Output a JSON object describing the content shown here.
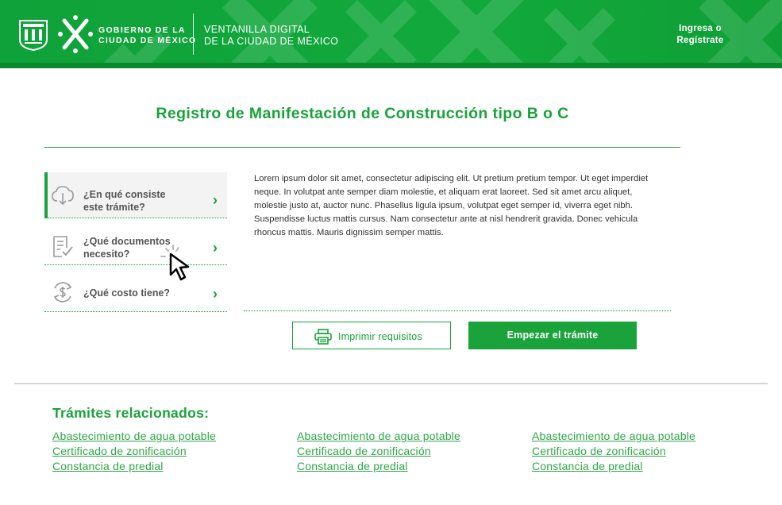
{
  "header": {
    "gov_name_line1": "GOBIERNO DE LA",
    "gov_name_line2": "CIUDAD DE MÉXICO",
    "portal_line1": "VENTANILLA DIGITAL",
    "portal_line2": "DE LA CIUDAD DE MÉXICO",
    "login_line1": "Ingresa o",
    "login_line2": "Regístrate"
  },
  "page": {
    "title": "Registro de Manifestación de Construcción tipo B o C"
  },
  "accordion": [
    {
      "label_line1": "¿En qué consiste",
      "label_line2": "este trámite?",
      "icon": "cloud-download-icon",
      "active": true
    },
    {
      "label_line1": "¿Qué documentos",
      "label_line2": "necesito?",
      "icon": "document-check-icon",
      "active": false
    },
    {
      "label_line1": "¿Qué costo tiene?",
      "label_line2": "",
      "icon": "money-cycle-icon",
      "active": false
    }
  ],
  "chevron": "›",
  "content": {
    "text": "Lorem ipsum dolor sit amet, consectetur adipiscing elit. Ut pretium pretium tempor. Ut eget imperdiet neque. In volutpat ante semper diam molestie, et aliquam erat laoreet. Sed sit amet arcu aliquet, molestie justo at, auctor nunc. Phasellus ligula ipsum, volutpat eget semper id, viverra eget nibh. Suspendisse luctus mattis cursus. Nam consectetur ante at nisl hendrerit gravida. Donec vehicula rhoncus mattis. Mauris dignissim semper mattis."
  },
  "actions": {
    "print_label": "Imprimir requisitos",
    "start_label": "Empezar el trámite"
  },
  "related": {
    "title": "Trámites relacionados:",
    "columns": [
      [
        "Abastecimiento de agua potable",
        "Certificado de zonificación",
        "Constancia de predial"
      ],
      [
        "Abastecimiento de agua potable",
        "Certificado de zonificación",
        "Constancia de predial"
      ],
      [
        "Abastecimiento de agua potable",
        "Certificado de zonificación",
        "Constancia de predial"
      ]
    ]
  },
  "colors": {
    "brand_green": "#19a33a",
    "header_green": "#12a93c",
    "link_green": "#2fa847"
  }
}
